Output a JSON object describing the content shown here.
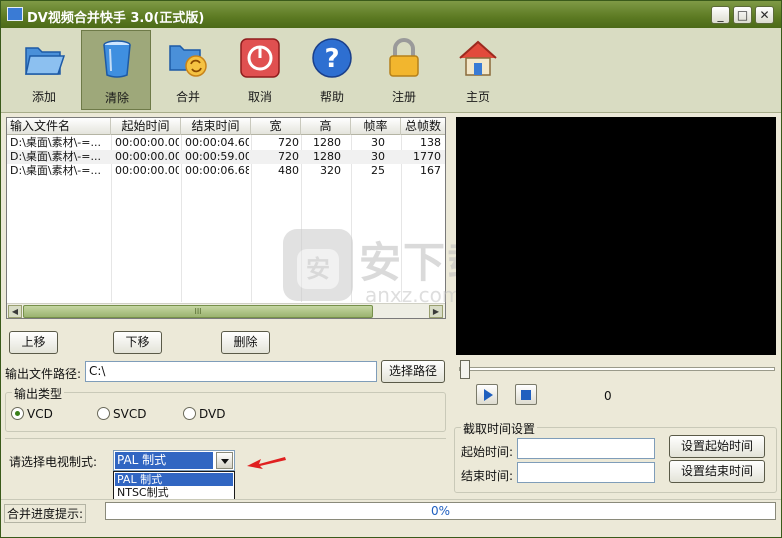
{
  "window": {
    "title": "DV视频合并快手 3.0(正式版)",
    "min_icon": "_",
    "max_icon": "□",
    "close_icon": "✕"
  },
  "toolbar": {
    "add": "添加",
    "clear": "清除",
    "merge": "合并",
    "cancel": "取消",
    "help": "帮助",
    "register": "注册",
    "home": "主页"
  },
  "table": {
    "columns": [
      "输入文件名",
      "起始时间",
      "结束时间",
      "宽",
      "高",
      "帧率",
      "总帧数"
    ],
    "rows": [
      [
        "D:\\桌面\\素材\\-=...",
        "00:00:00.00",
        "00:00:04.60",
        "720",
        "1280",
        "30",
        "138"
      ],
      [
        "D:\\桌面\\素材\\-=...",
        "00:00:00.00",
        "00:00:59.00",
        "720",
        "1280",
        "30",
        "1770"
      ],
      [
        "D:\\桌面\\素材\\-=...",
        "00:00:00.00",
        "00:00:06.68",
        "480",
        "320",
        "25",
        "167"
      ]
    ],
    "scroll_left": "◀",
    "scroll_right": "▶",
    "scroll_grip": "III"
  },
  "list_buttons": {
    "up": "上移",
    "down": "下移",
    "delete": "删除"
  },
  "output": {
    "path_label": "输出文件路径:",
    "path_value": "C:\\",
    "choose_button": "选择路径"
  },
  "output_type": {
    "title": "输出类型",
    "options": [
      "VCD",
      "SVCD",
      "DVD"
    ],
    "selected": "VCD"
  },
  "tv_standard": {
    "label": "请选择电视制式:",
    "selected": "PAL 制式",
    "options": [
      "PAL 制式",
      "NTSC制式"
    ]
  },
  "player": {
    "frame_counter": "0",
    "position": 0
  },
  "clip": {
    "title": "截取时间设置",
    "start_label": "起始时间:",
    "end_label": "结束时间:",
    "start_value": "",
    "end_value": "",
    "set_start_button": "设置起始时间",
    "set_end_button": "设置结束时间"
  },
  "progress": {
    "label": "合并进度提示:",
    "value_text": "0%",
    "value": 0
  },
  "watermark": {
    "cn": "安下载",
    "en": "anxz.com",
    "bag_char": "安"
  },
  "colors": {
    "titlebar": "#5c7a22",
    "accent_blue": "#1f5fbf",
    "selection": "#3166c2",
    "arrow_red": "#e02020"
  }
}
